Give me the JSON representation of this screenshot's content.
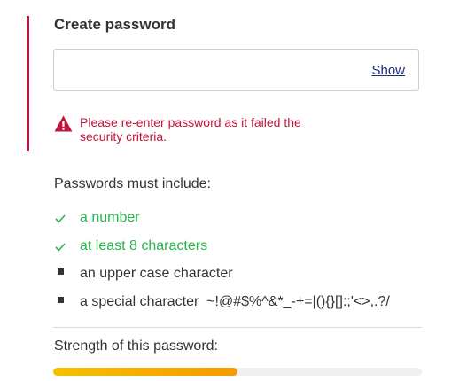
{
  "form": {
    "label": "Create password",
    "input_value": "",
    "show_label": "Show",
    "error_message": "Please re-enter password as it failed the security criteria.",
    "error_icon": "warning-icon"
  },
  "rules": {
    "title": "Passwords must include:",
    "items": [
      {
        "label": "a number",
        "met": true
      },
      {
        "label": "at least 8 characters",
        "met": true
      },
      {
        "label": "an upper case character",
        "met": false
      },
      {
        "label": "a special character  ~!@#$%^&*_-+=|(){}[]:;'<>,.?/",
        "met": false
      }
    ]
  },
  "strength": {
    "label": "Strength of this password:",
    "value": 0.5
  },
  "colors": {
    "error": "#c0143c",
    "met": "#27b34a",
    "link": "#1d2a78",
    "strength_start": "#f6c000",
    "strength_end": "#f59a00"
  }
}
